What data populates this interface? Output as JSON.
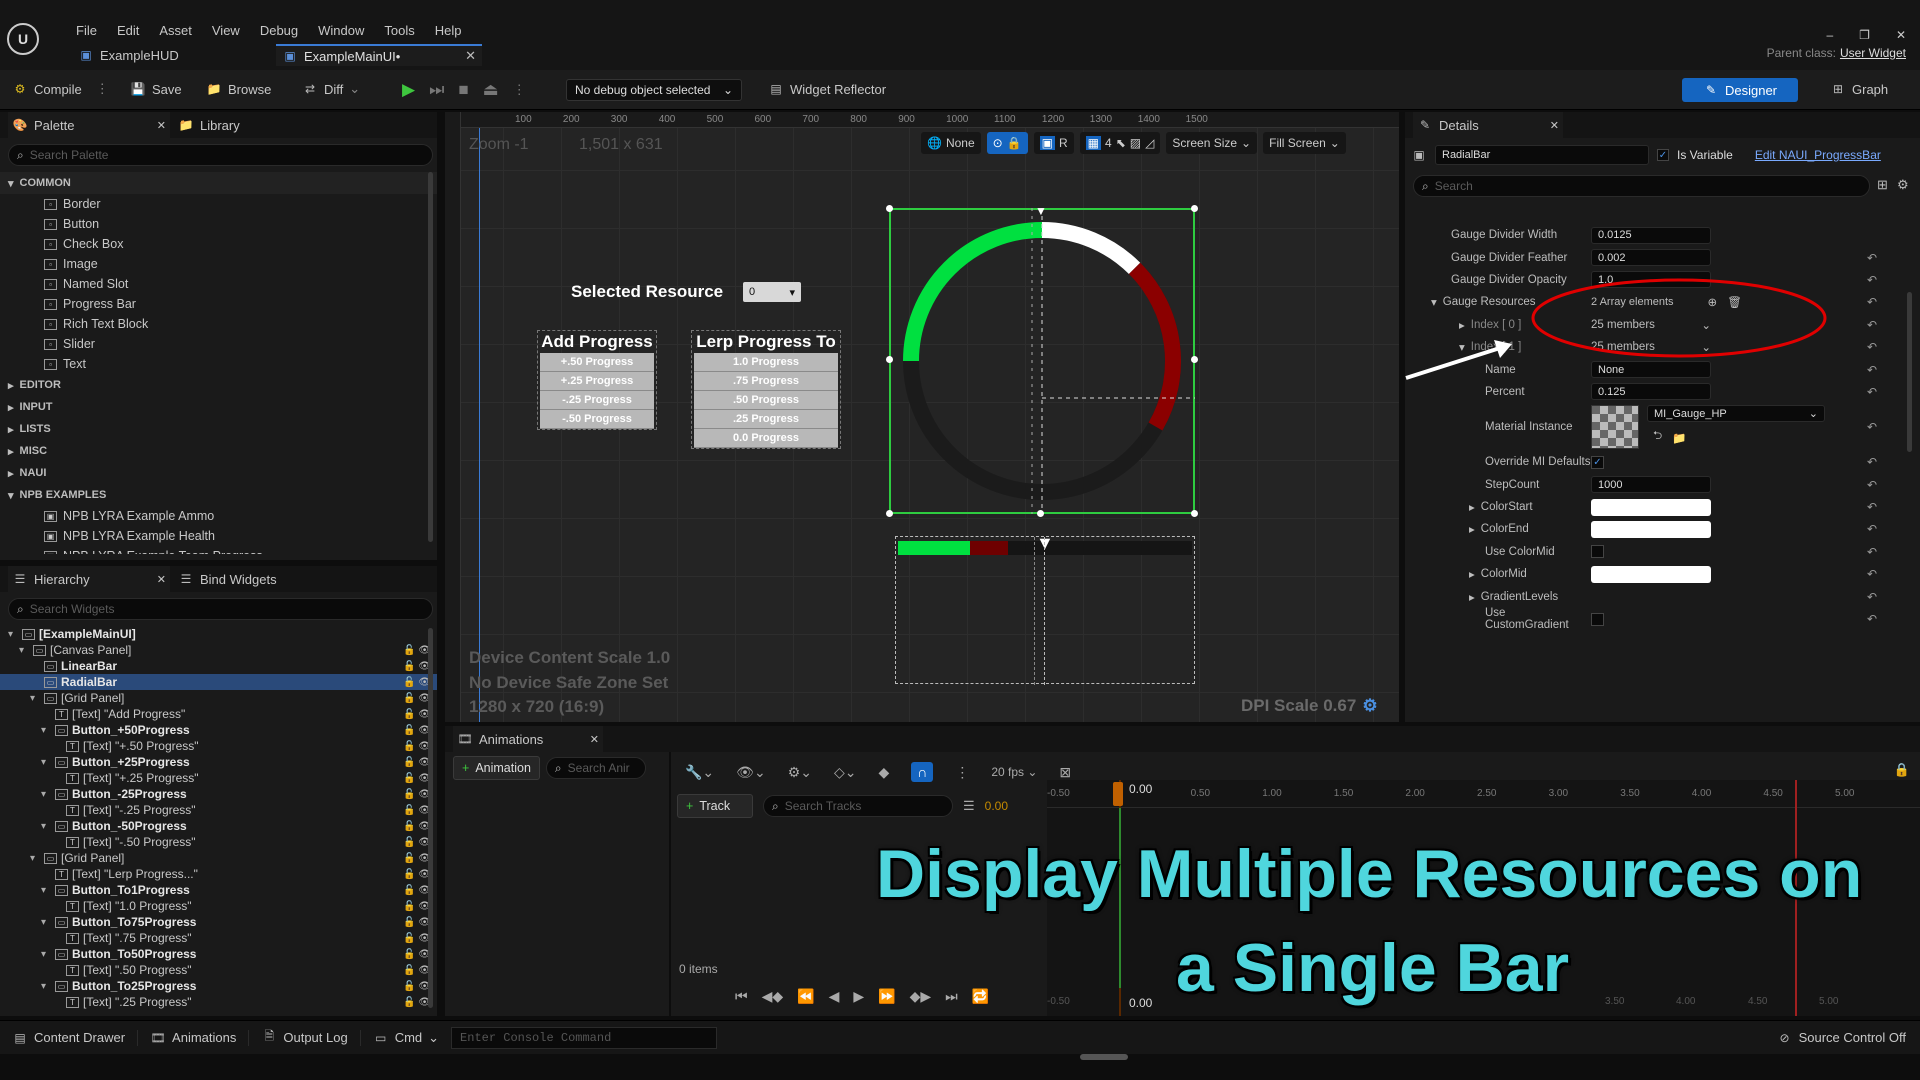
{
  "menu": [
    "File",
    "Edit",
    "Asset",
    "View",
    "Debug",
    "Window",
    "Tools",
    "Help"
  ],
  "doc_tabs": [
    {
      "label": "ExampleHUD"
    },
    {
      "label": "ExampleMainUI•"
    }
  ],
  "parent_class": {
    "label": "Parent class:",
    "value": "User Widget"
  },
  "toolbar": {
    "compile": "Compile",
    "save": "Save",
    "browse": "Browse",
    "diff": "Diff",
    "debug_select": "No debug object selected",
    "widget_reflector": "Widget Reflector",
    "designer": "Designer",
    "graph": "Graph"
  },
  "palette": {
    "tab": "Palette",
    "library_tab": "Library",
    "search_placeholder": "Search Palette",
    "common_label": "COMMON",
    "common_items": [
      "Border",
      "Button",
      "Check Box",
      "Image",
      "Named Slot",
      "Progress Bar",
      "Rich Text Block",
      "Slider",
      "Text"
    ],
    "categories": [
      "EDITOR",
      "INPUT",
      "LISTS",
      "MISC",
      "NAUI"
    ],
    "npb_label": "NPB EXAMPLES",
    "npb_items": [
      "NPB LYRA Example Ammo",
      "NPB LYRA Example Health",
      "NPB LYRA Example Team Progress"
    ]
  },
  "hierarchy": {
    "tab": "Hierarchy",
    "bind_tab": "Bind Widgets",
    "search_placeholder": "Search Widgets",
    "rows": [
      {
        "label": "[ExampleMainUI]",
        "bold": true
      },
      {
        "label": "[Canvas Panel]",
        "bold": false
      },
      {
        "label": "LinearBar",
        "bold": true
      },
      {
        "label": "RadialBar",
        "bold": true,
        "selected": true
      },
      {
        "label": "[Grid Panel]",
        "bold": false
      },
      {
        "label": "[Text] \"Add Progress\"",
        "bold": false
      },
      {
        "label": "Button_+50Progress",
        "bold": true
      },
      {
        "label": "[Text] \"+.50 Progress\"",
        "bold": false
      },
      {
        "label": "Button_+25Progress",
        "bold": true
      },
      {
        "label": "[Text] \"+.25 Progress\"",
        "bold": false
      },
      {
        "label": "Button_-25Progress",
        "bold": true
      },
      {
        "label": "[Text] \"-.25 Progress\"",
        "bold": false
      },
      {
        "label": "Button_-50Progress",
        "bold": true
      },
      {
        "label": "[Text] \"-.50 Progress\"",
        "bold": false
      },
      {
        "label": "[Grid Panel]",
        "bold": false
      },
      {
        "label": "[Text] \"Lerp Progress...\"",
        "bold": false
      },
      {
        "label": "Button_To1Progress",
        "bold": true
      },
      {
        "label": "[Text] \"1.0 Progress\"",
        "bold": false
      },
      {
        "label": "Button_To75Progress",
        "bold": true
      },
      {
        "label": "[Text] \".75 Progress\"",
        "bold": false
      },
      {
        "label": "Button_To50Progress",
        "bold": true
      },
      {
        "label": "[Text] \".50 Progress\"",
        "bold": false
      },
      {
        "label": "Button_To25Progress",
        "bold": true
      },
      {
        "label": "[Text] \".25 Progress\"",
        "bold": false
      }
    ]
  },
  "viewport": {
    "ruler_ticks": [
      "100",
      "200",
      "300",
      "400",
      "500",
      "600",
      "700",
      "800",
      "900",
      "1000",
      "1100",
      "1200",
      "1300",
      "1400",
      "1500"
    ],
    "zoom": "Zoom -1",
    "size": "1,501 x 631",
    "none_label": "None",
    "r_label": "R",
    "grid_num": "4",
    "screen_size": "Screen Size",
    "fill_screen": "Fill Screen",
    "device_scale": "Device Content Scale 1.0",
    "safe_zone": "No Device Safe Zone Set",
    "resolution": "1280 x 720 (16:9)",
    "dpi": "DPI Scale 0.67",
    "selected_resource": "Selected Resource",
    "resource_value": "0",
    "add_title": "Add Progress",
    "add_buttons": [
      "+.50 Progress",
      "+.25 Progress",
      "-.25 Progress",
      "-.50 Progress"
    ],
    "lerp_title": "Lerp Progress To",
    "lerp_buttons": [
      "1.0 Progress",
      ".75 Progress",
      ".50 Progress",
      ".25 Progress",
      "0.0 Progress"
    ],
    "colors": {
      "green": "#00e040",
      "red": "#8b0000",
      "dark": "#1a1a1a",
      "white": "#ffffff"
    }
  },
  "details": {
    "tab": "Details",
    "widget_name": "RadialBar",
    "is_variable": "Is Variable",
    "edit_link": "Edit NAUI_ProgressBar",
    "search_placeholder": "Search",
    "rows": [
      {
        "label": "Gauge Divider Width",
        "value": "0.0125"
      },
      {
        "label": "Gauge Divider Feather",
        "value": "0.002"
      },
      {
        "label": "Gauge Divider Opacity",
        "value": "1.0"
      }
    ],
    "gauge_resources": "Gauge Resources",
    "array_elements": "2 Array elements",
    "index0": "Index [ 0 ]",
    "index1": "Index [ 1 ]",
    "members": "25 members",
    "name_label": "Name",
    "name_value": "None",
    "percent_label": "Percent",
    "percent_value": "0.125",
    "material_label": "Material Instance",
    "material_value": "MI_Gauge_HP",
    "override_label": "Override MI Defaults",
    "stepcount_label": "StepCount",
    "stepcount_value": "1000",
    "colorstart": "ColorStart",
    "colorend": "ColorEnd",
    "usecolormid": "Use ColorMid",
    "colormid": "ColorMid",
    "gradientlevels": "GradientLevels",
    "usecustomgradient": "Use CustomGradient"
  },
  "animations": {
    "tab": "Animations",
    "add": "Animation",
    "search_placeholder": "Search Anir",
    "fps": "20 fps",
    "track": "Track",
    "search_tracks": "Search Tracks",
    "time": "0.00",
    "time_marker": "0.00",
    "items": "0 items",
    "ticks": [
      "-0.50",
      "0.50",
      "1.00",
      "1.50",
      "2.00",
      "2.50",
      "3.00",
      "3.50",
      "4.00",
      "4.50",
      "5.00"
    ],
    "bottom_ticks": [
      "-0.50",
      "3.50",
      "4.00",
      "4.50",
      "5.00"
    ]
  },
  "bottom": {
    "content_drawer": "Content Drawer",
    "animations": "Animations",
    "output_log": "Output Log",
    "cmd": "Cmd",
    "console_placeholder": "Enter Console Command",
    "source_control": "Source Control Off"
  },
  "overlay": {
    "line1": "Display Multiple Resources on",
    "line2": "a Single Bar"
  }
}
